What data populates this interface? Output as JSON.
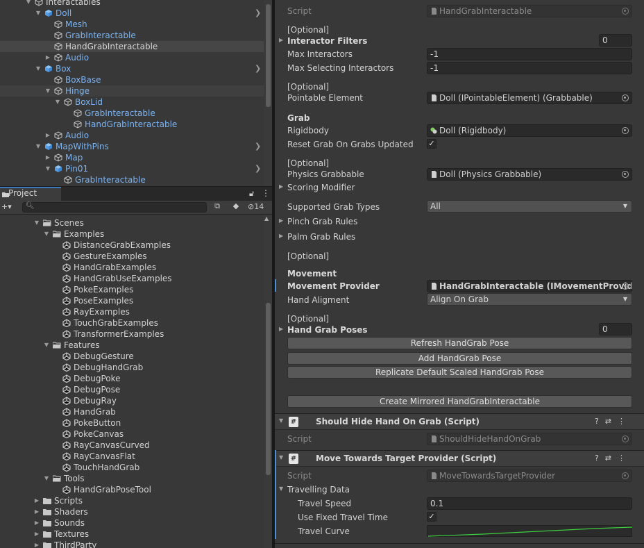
{
  "hierarchy": {
    "rows": [
      {
        "label": "Interactables",
        "color": "white",
        "indent": 0,
        "fold": "down",
        "icon": "cube-outline-icon",
        "chevron": false,
        "sel": ""
      },
      {
        "label": "Doll",
        "color": "blue",
        "indent": 1,
        "fold": "down",
        "icon": "prefab-cube-icon",
        "chevron": true,
        "sel": ""
      },
      {
        "label": "Mesh",
        "color": "blue",
        "indent": 2,
        "fold": "",
        "icon": "cube-outline-icon",
        "chevron": false,
        "sel": ""
      },
      {
        "label": "GrabInteractable",
        "color": "blue",
        "indent": 2,
        "fold": "",
        "icon": "cube-outline-icon",
        "chevron": false,
        "sel": ""
      },
      {
        "label": "HandGrabInteractable",
        "color": "white",
        "indent": 2,
        "fold": "",
        "icon": "cube-outline-icon",
        "chevron": false,
        "sel": "sel"
      },
      {
        "label": "Audio",
        "color": "blue",
        "indent": 2,
        "fold": "right",
        "icon": "cube-outline-icon",
        "chevron": false,
        "sel": ""
      },
      {
        "label": "Box",
        "color": "blue",
        "indent": 1,
        "fold": "down",
        "icon": "prefab-cube-icon",
        "chevron": true,
        "sel": ""
      },
      {
        "label": "BoxBase",
        "color": "blue",
        "indent": 2,
        "fold": "",
        "icon": "cube-outline-icon",
        "chevron": false,
        "sel": ""
      },
      {
        "label": "Hinge",
        "color": "blue",
        "indent": 2,
        "fold": "down",
        "icon": "cube-outline-icon",
        "chevron": false,
        "sel": "sel2"
      },
      {
        "label": "BoxLid",
        "color": "blue",
        "indent": 3,
        "fold": "down",
        "icon": "cube-outline-icon",
        "chevron": false,
        "sel": ""
      },
      {
        "label": "GrabInteractable",
        "color": "blue",
        "indent": 4,
        "fold": "",
        "icon": "cube-outline-icon",
        "chevron": false,
        "sel": ""
      },
      {
        "label": "HandGrabInteractable",
        "color": "blue",
        "indent": 4,
        "fold": "",
        "icon": "cube-outline-icon",
        "chevron": false,
        "sel": ""
      },
      {
        "label": "Audio",
        "color": "blue",
        "indent": 2,
        "fold": "right",
        "icon": "cube-outline-icon",
        "chevron": false,
        "sel": ""
      },
      {
        "label": "MapWithPins",
        "color": "blue",
        "indent": 1,
        "fold": "down",
        "icon": "prefab-cube-icon",
        "chevron": true,
        "sel": ""
      },
      {
        "label": "Map",
        "color": "blue",
        "indent": 2,
        "fold": "right",
        "icon": "cube-outline-icon",
        "chevron": false,
        "sel": ""
      },
      {
        "label": "Pin01",
        "color": "blue",
        "indent": 2,
        "fold": "down",
        "icon": "prefab-cube-icon",
        "chevron": true,
        "sel": ""
      },
      {
        "label": "GrabInteractable",
        "color": "blue",
        "indent": 3,
        "fold": "",
        "icon": "cube-outline-icon",
        "chevron": false,
        "sel": ""
      }
    ]
  },
  "project": {
    "tab_label": "Project",
    "hidden_count": "14",
    "search_placeholder": "",
    "rows": [
      {
        "label": "Scenes",
        "indent": 0,
        "fold": "down",
        "icon": "folder-open-icon"
      },
      {
        "label": "Examples",
        "indent": 1,
        "fold": "down",
        "icon": "folder-open-icon"
      },
      {
        "label": "DistanceGrabExamples",
        "indent": 2,
        "fold": "",
        "icon": "unity-scene-icon"
      },
      {
        "label": "GestureExamples",
        "indent": 2,
        "fold": "",
        "icon": "unity-scene-icon"
      },
      {
        "label": "HandGrabExamples",
        "indent": 2,
        "fold": "",
        "icon": "unity-scene-icon"
      },
      {
        "label": "HandGrabUseExamples",
        "indent": 2,
        "fold": "",
        "icon": "unity-scene-icon"
      },
      {
        "label": "PokeExamples",
        "indent": 2,
        "fold": "",
        "icon": "unity-scene-icon"
      },
      {
        "label": "PoseExamples",
        "indent": 2,
        "fold": "",
        "icon": "unity-scene-icon"
      },
      {
        "label": "RayExamples",
        "indent": 2,
        "fold": "",
        "icon": "unity-scene-icon"
      },
      {
        "label": "TouchGrabExamples",
        "indent": 2,
        "fold": "",
        "icon": "unity-scene-icon"
      },
      {
        "label": "TransformerExamples",
        "indent": 2,
        "fold": "",
        "icon": "unity-scene-icon"
      },
      {
        "label": "Features",
        "indent": 1,
        "fold": "down",
        "icon": "folder-open-icon"
      },
      {
        "label": "DebugGesture",
        "indent": 2,
        "fold": "",
        "icon": "unity-scene-icon"
      },
      {
        "label": "DebugHandGrab",
        "indent": 2,
        "fold": "",
        "icon": "unity-scene-icon"
      },
      {
        "label": "DebugPoke",
        "indent": 2,
        "fold": "",
        "icon": "unity-scene-icon"
      },
      {
        "label": "DebugPose",
        "indent": 2,
        "fold": "",
        "icon": "unity-scene-icon"
      },
      {
        "label": "DebugRay",
        "indent": 2,
        "fold": "",
        "icon": "unity-scene-icon"
      },
      {
        "label": "HandGrab",
        "indent": 2,
        "fold": "",
        "icon": "unity-scene-icon"
      },
      {
        "label": "PokeButton",
        "indent": 2,
        "fold": "",
        "icon": "unity-scene-icon"
      },
      {
        "label": "PokeCanvas",
        "indent": 2,
        "fold": "",
        "icon": "unity-scene-icon"
      },
      {
        "label": "RayCanvasCurved",
        "indent": 2,
        "fold": "",
        "icon": "unity-scene-icon"
      },
      {
        "label": "RayCanvasFlat",
        "indent": 2,
        "fold": "",
        "icon": "unity-scene-icon"
      },
      {
        "label": "TouchHandGrab",
        "indent": 2,
        "fold": "",
        "icon": "unity-scene-icon"
      },
      {
        "label": "Tools",
        "indent": 1,
        "fold": "down",
        "icon": "folder-open-icon"
      },
      {
        "label": "HandGrabPoseTool",
        "indent": 2,
        "fold": "",
        "icon": "unity-scene-icon"
      },
      {
        "label": "Scripts",
        "indent": 0,
        "fold": "right",
        "icon": "folder-icon"
      },
      {
        "label": "Shaders",
        "indent": 0,
        "fold": "right",
        "icon": "folder-icon"
      },
      {
        "label": "Sounds",
        "indent": 0,
        "fold": "right",
        "icon": "folder-icon"
      },
      {
        "label": "Textures",
        "indent": 0,
        "fold": "right",
        "icon": "folder-icon"
      },
      {
        "label": "ThirdParty",
        "indent": 0,
        "fold": "right",
        "icon": "folder-icon"
      }
    ]
  },
  "inspector": {
    "script_label": "Script",
    "script_value": "HandGrabInteractable",
    "optional": "[Optional]",
    "interactor_filters_label": "Interactor Filters",
    "interactor_filters_value": "0",
    "max_interactors_label": "Max Interactors",
    "max_interactors_value": "-1",
    "max_selecting_label": "Max Selecting Interactors",
    "max_selecting_value": "-1",
    "pointable_label": "Pointable Element",
    "pointable_value": "Doll (IPointableElement) (Grabbable)",
    "grab_header": "Grab",
    "rigidbody_label": "Rigidbody",
    "rigidbody_value": "Doll (Rigidbody)",
    "reset_grab_label": "Reset Grab On Grabs Updated",
    "physics_label": "Physics Grabbable",
    "physics_value": "Doll (Physics Grabbable)",
    "scoring_label": "Scoring Modifier",
    "supported_label": "Supported Grab Types",
    "supported_value": "All",
    "pinch_label": "Pinch Grab Rules",
    "palm_label": "Palm Grab Rules",
    "movement_header": "Movement",
    "movement_label": "Movement Provider",
    "movement_value": "HandGrabInteractable (IMovementProvider)",
    "hand_align_label": "Hand Aligment",
    "hand_align_value": "Align On Grab",
    "hand_poses_label": "Hand Grab Poses",
    "hand_poses_value": "0",
    "btn_refresh": "Refresh HandGrab Pose",
    "btn_add": "Add HandGrab Pose",
    "btn_replicate": "Replicate Default Scaled HandGrab Pose",
    "btn_mirror": "Create Mirrored HandGrabInteractable"
  },
  "hide_hand": {
    "title": "Should Hide Hand On Grab (Script)",
    "script_label": "Script",
    "script_value": "ShouldHideHandOnGrab"
  },
  "move_towards": {
    "title": "Move Towards Target Provider (Script)",
    "script_label": "Script",
    "script_value": "MoveTowardsTargetProvider",
    "travelling_label": "Travelling Data",
    "speed_label": "Travel Speed",
    "speed_value": "0.1",
    "fixed_label": "Use Fixed Travel Time",
    "curve_label": "Travel Curve"
  },
  "colors": {
    "accent": "#3a79bb",
    "prefab": "#7cb4f1",
    "curve": "#3fcf3f"
  }
}
